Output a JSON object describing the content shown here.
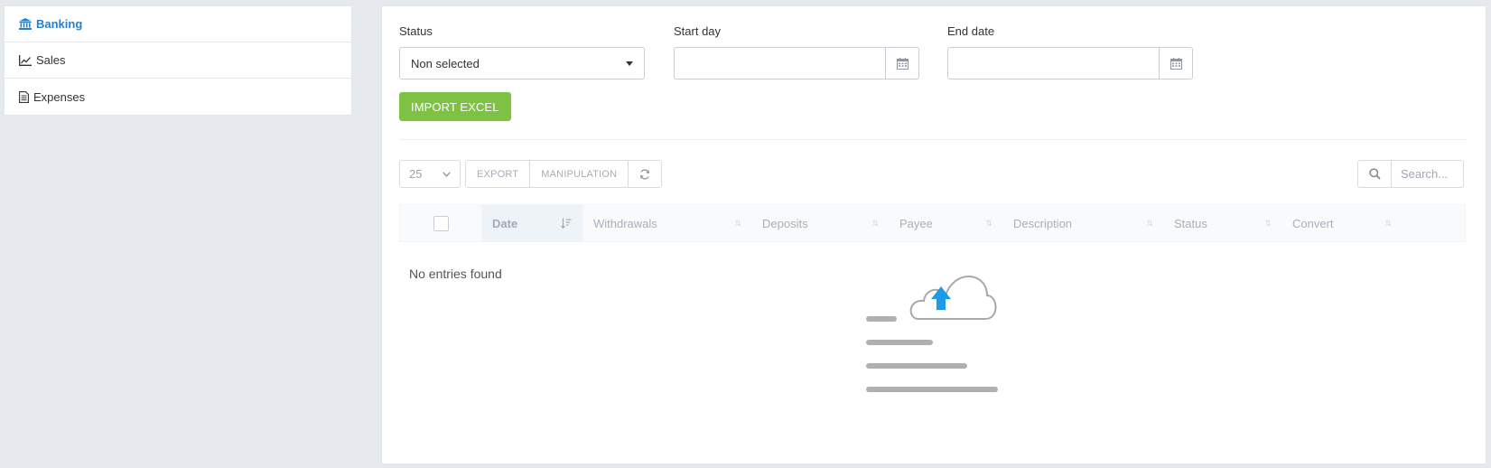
{
  "sidebar": {
    "items": [
      {
        "label": "Banking",
        "icon": "bank-icon",
        "active": true
      },
      {
        "label": "Sales",
        "icon": "line-chart-icon",
        "active": false
      },
      {
        "label": "Expenses",
        "icon": "document-icon",
        "active": false
      }
    ]
  },
  "filters": {
    "status_label": "Status",
    "status_value": "Non selected",
    "start_label": "Start day",
    "start_value": "",
    "end_label": "End date",
    "end_value": ""
  },
  "import_button": "IMPORT EXCEL",
  "toolbar": {
    "page_size": "25",
    "export": "EXPORT",
    "manipulation": "MANIPULATION"
  },
  "search": {
    "placeholder": "Search..."
  },
  "table": {
    "columns": [
      "Date",
      "Withdrawals",
      "Deposits",
      "Payee",
      "Description",
      "Status",
      "Convert"
    ],
    "empty_message": "No entries found"
  },
  "colors": {
    "accent": "#2a7fc9",
    "import_button": "#7dc243",
    "upload_arrow": "#1e9be8"
  }
}
